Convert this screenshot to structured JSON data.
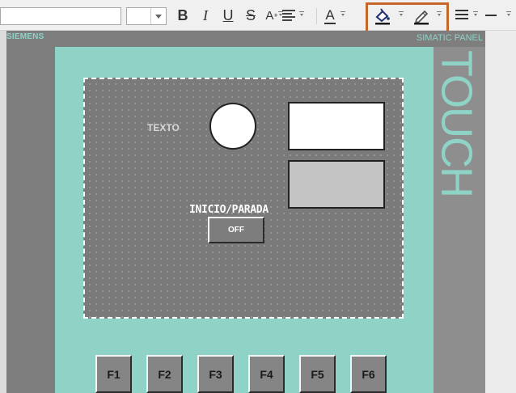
{
  "toolbar": {
    "font_name": "",
    "font_size": "",
    "bold": "B",
    "italic": "I",
    "underline": "U",
    "strikethrough": "S",
    "superscript_base": "A",
    "superscript_mark": "+",
    "font_color": "A",
    "icons": [
      "chevron-down-icon",
      "bold-icon",
      "italic-icon",
      "underline-icon",
      "strikethrough-icon",
      "superscript-icon",
      "align-icon",
      "font-color-icon",
      "fill-color-icon",
      "line-color-icon",
      "line-style-icon",
      "line-width-icon"
    ],
    "highlight_color": "#c5662a"
  },
  "panel": {
    "brand": "SIEMENS",
    "model": "SIMATIC PANEL",
    "side_label": "TOUCH",
    "body_color": "#8fd2c6",
    "frame_color": "#7e7e7e"
  },
  "screen": {
    "text_label": "TEXTO",
    "start_stop_label": "INICIO/PARADA",
    "toggle_button": "OFF"
  },
  "function_keys": [
    "F1",
    "F2",
    "F3",
    "F4",
    "F5",
    "F6"
  ]
}
